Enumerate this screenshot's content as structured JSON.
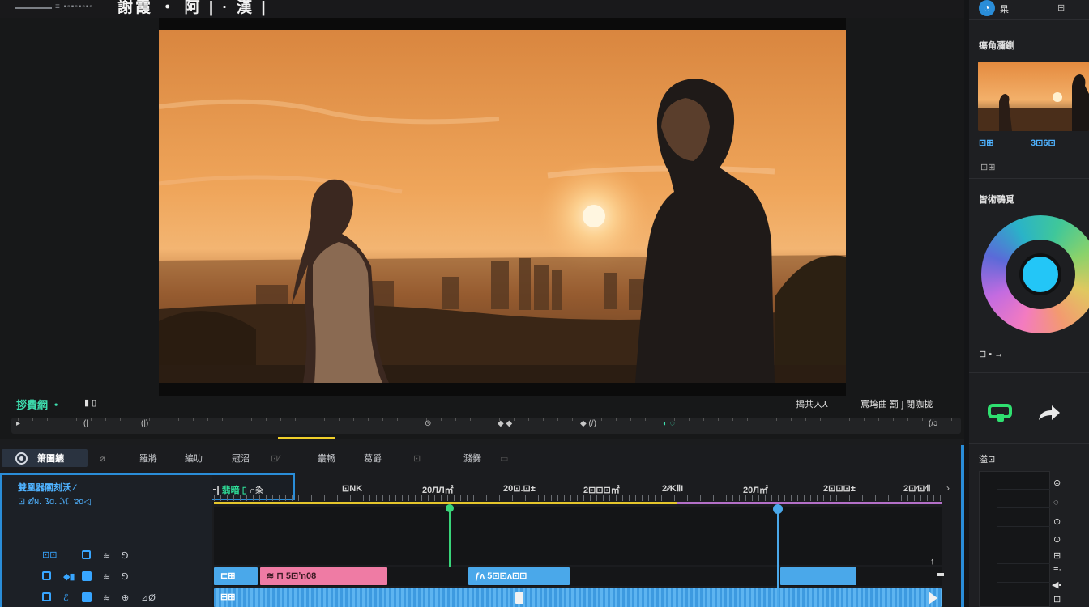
{
  "window": {
    "menu_glyphs": "≡ ▪▫▪▫▪▫▪▫",
    "project_title": "謝霞 ・ 阿 | · 漢 |"
  },
  "viewer": {
    "left_label": "拶費網 ‧",
    "left_label2": "▮ ▯",
    "right_label_a": "揭共人⅄",
    "right_label_b": "罵垮曲  罰 ] 閉咖拢",
    "scrub_marks": [
      "▸",
      "(|",
      "(|)",
      "⊙",
      "◆  ◆",
      "◆  (/)",
      "◐  ◌",
      "(/ɔ"
    ]
  },
  "timeline": {
    "tabs": [
      "箫圖鑣",
      "⌀",
      "羅將",
      "編叻",
      "冠沼",
      "⊡⁄",
      "叢畅",
      "葛爵",
      "⊡",
      "濺爨",
      "▭"
    ],
    "header_title": "雙凰器關刻沃 ⁄",
    "header_sub": "⊡  ⅆ̸ɴ.  ßɑ.  ℳ.  ɐɑ◁",
    "timecode_prefix": "⁃|",
    "timecode_green": "翡暗 ▯",
    "timecode_suffix": "∩粂",
    "ruler": [
      "⊡ΝΚ",
      "20ЛЛ㎡",
      "20⊡.⊡±",
      "2⊡⊡⊡㎡",
      "2⁄⁄ΚⅡΙ",
      "20Л㎡",
      "2⊡⊡⊡±",
      "2⊡⁄⊡⁄Ⅱ"
    ],
    "tracks": [
      {
        "icons": [
          "⊡⊡",
          "▢",
          "≋",
          "⅁"
        ]
      },
      {
        "icons": [
          "▢",
          "◆▮",
          "▆",
          "≋",
          "⅁"
        ]
      },
      {
        "icons": [
          "▢",
          "ℰ",
          "▆",
          "≋",
          "⊕",
          "⊿Ø"
        ]
      }
    ],
    "clips": [
      {
        "label": "⊏⊞"
      },
      {
        "label": "≋  ⊓   5⊡ʼn08"
      },
      {
        "label": "ƒʌ  5⊡⊡ʌ⊡⊡"
      },
      {
        "label": ""
      },
      {
        "label": "⊟⊞"
      }
    ]
  },
  "right_panel": {
    "top_icon": "◔",
    "top_label": "㫧",
    "top_icon2": "⊞",
    "section1": "瘍角瀰鍘",
    "thumb_label": "⊡⊞",
    "thumb_value": "3⊡6⊡",
    "section2": "⊡⊞",
    "section3": "皆術鶚覓",
    "wheel_icons": "⊟  ▪ →",
    "section4": "溢⊡",
    "side_icons": [
      "⊜",
      "◌",
      "⊙",
      "⊙",
      "⊞",
      "≡·",
      "◀▪",
      "⊡"
    ]
  },
  "colors": {
    "accent_blue": "#4aa8ea",
    "accent_green": "#39d57a",
    "accent_yellow": "#e5c62c",
    "accent_pink": "#ef7ba4",
    "wheel_core": "#23c6f7"
  }
}
